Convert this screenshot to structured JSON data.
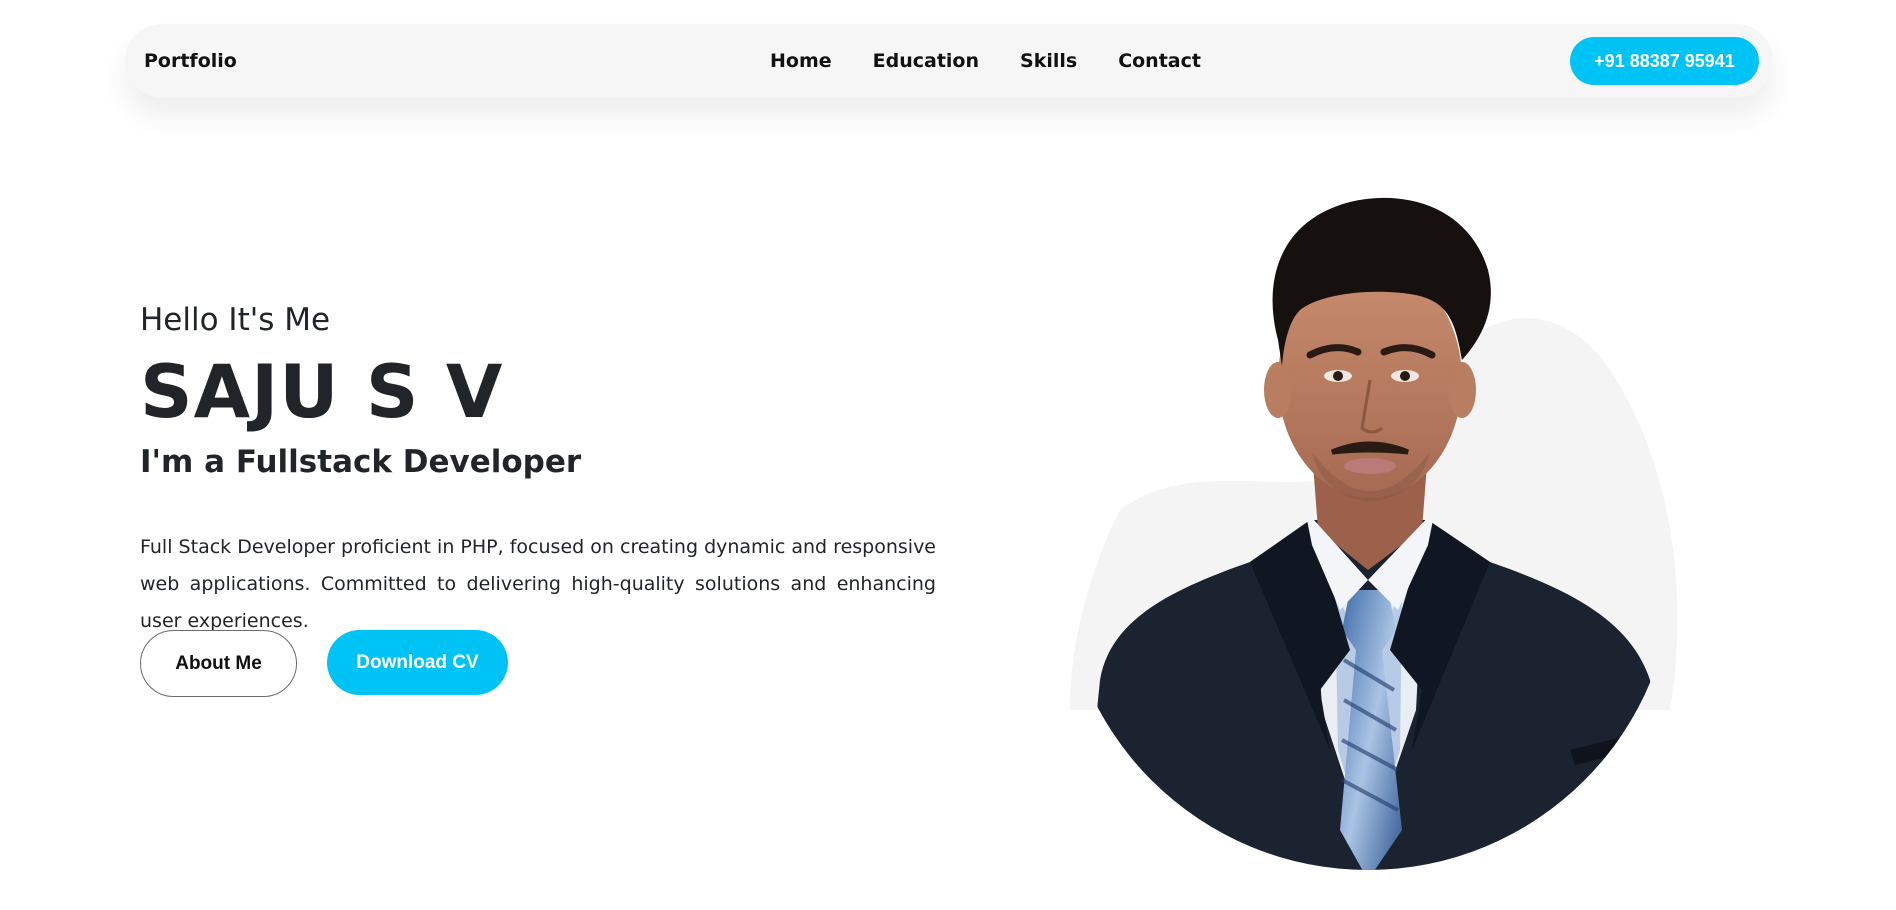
{
  "navbar": {
    "brand": "Portfolio",
    "links": [
      "Home",
      "Education",
      "Skills",
      "Contact"
    ],
    "phone": "+91 88387 95941"
  },
  "hero": {
    "greeting": "Hello It's Me",
    "name": "SAJU S V",
    "role_prefix": "I'm a",
    "role_highlight": "Fullstack Developer",
    "description": "Full Stack Developer proficient in PHP, focused on creating dynamic and responsive web applications. Committed to delivering high-quality solutions and enhancing user experiences.",
    "about_button": "About Me",
    "cv_button": "Download CV"
  },
  "colors": {
    "accent": "#00c3f5",
    "nav_bg": "#f6f6f6",
    "text": "#212529",
    "suit": "#1b2230"
  }
}
